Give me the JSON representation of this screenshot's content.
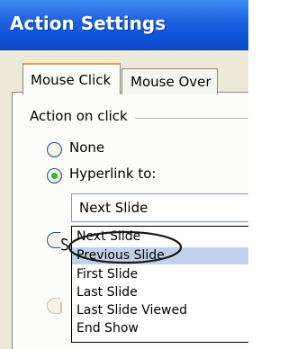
{
  "window": {
    "title": "Action Settings"
  },
  "tabs": [
    {
      "label": "Mouse Click",
      "active": true
    },
    {
      "label": "Mouse Over",
      "active": false
    }
  ],
  "group": {
    "label": "Action on click"
  },
  "options": {
    "none_label": "None",
    "hyperlink_label": "Hyperlink to:",
    "hyperlink_selected": true
  },
  "combo": {
    "value": "Next Slide"
  },
  "dropdown": {
    "items": [
      "Next Slide",
      "Previous Slide",
      "First Slide",
      "Last Slide",
      "Last Slide Viewed",
      "End Show"
    ],
    "highlighted": "Previous Slide"
  },
  "colors": {
    "titlebar": "#0e52d6",
    "selection": "#bfd1ea",
    "radio_dot": "#2fb52f",
    "annotation": "#1a1a1a"
  }
}
